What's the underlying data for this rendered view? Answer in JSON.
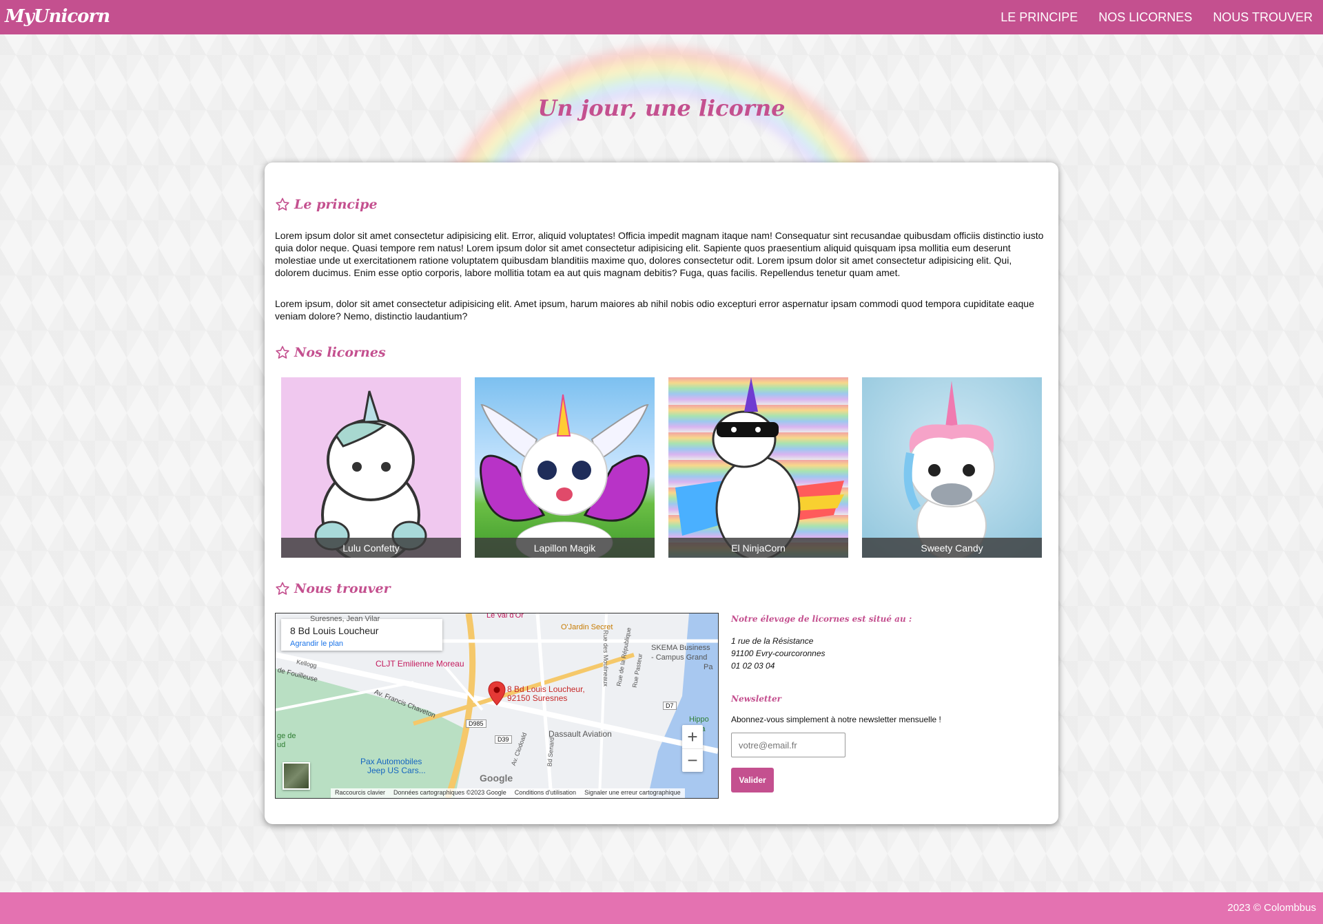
{
  "brand": "MyUnicorn",
  "nav": [
    "LE PRINCIPE",
    "NOS LICORNES",
    "NOUS TROUVER"
  ],
  "hero": {
    "title": "Un jour, une licorne"
  },
  "principe": {
    "title": "Le principe",
    "p1": "Lorem ipsum dolor sit amet consectetur adipisicing elit. Error, aliquid voluptates! Officia impedit magnam itaque nam! Consequatur sint recusandae quibusdam officiis distinctio iusto quia dolor neque. Quasi tempore rem natus! Lorem ipsum dolor sit amet consectetur adipisicing elit. Sapiente quos praesentium aliquid quisquam ipsa mollitia eum deserunt molestiae unde ut exercitationem ratione voluptatem quibusdam blanditiis maxime quo, dolores consectetur odit. Lorem ipsum dolor sit amet consectetur adipisicing elit. Qui, dolorem ducimus. Enim esse optio corporis, labore mollitia totam ea aut quis magnam debitis? Fuga, quas facilis. Repellendus tenetur quam amet.",
    "p2": "Lorem ipsum, dolor sit amet consectetur adipisicing elit. Amet ipsum, harum maiores ab nihil nobis odio excepturi error aspernatur ipsam commodi quod tempora cupiditate eaque veniam dolore? Nemo, distinctio laudantium?"
  },
  "licornes": {
    "title": "Nos licornes",
    "items": [
      {
        "name": "Lulu Confetty",
        "bg": "#f0c8ef"
      },
      {
        "name": "Lapillon Magik",
        "bg": "#8ec8f4"
      },
      {
        "name": "El NinjaCorn",
        "bg": "#c8b8d8"
      },
      {
        "name": "Sweety Candy",
        "bg": "#a9d4e6"
      }
    ]
  },
  "trouver": {
    "title": "Nous trouver",
    "map": {
      "place_title": "8 Bd Louis Loucheur",
      "enlarge": "Agrandir le plan",
      "marker_line1": "8 Bd Louis Loucheur,",
      "marker_line2": "92150 Suresnes",
      "labels": {
        "ojardin": "O'Jardin Secret",
        "cljt": "CLJT Emilienne Moreau",
        "skema": "SKEMA Business",
        "skema2": "- Campus Grand",
        "dassault": "Dassault Aviation",
        "pax": "Pax Automobiles",
        "jeep": "Jeep US Cars...",
        "francis": "Av. Francis Chaveton",
        "fouilleuse": "de Fouilleuse",
        "kellogg": "Kellogg",
        "levaldor": "Le Val d'Or",
        "suresnes": "Suresnes, Jean Vilar",
        "moulineaux": "Rue des Moulineaux",
        "republique": "Rue de la République",
        "pasteur": "Rue Pasteur",
        "clodoald": "Av. Clodoald",
        "senard": "Bd Senard",
        "hippo": "Hippo",
        "pa": "Pa",
        "pa2": "Pa",
        "gede": "ge de",
        "ud": "ud",
        "d985": "D985",
        "d39": "D39",
        "d7": "D7"
      },
      "google": "Google",
      "zoom_in": "+",
      "zoom_out": "−",
      "footer": [
        "Raccourcis clavier",
        "Données cartographiques ©2023 Google",
        "Conditions d'utilisation",
        "Signaler une erreur cartographique"
      ]
    },
    "location_heading": "Notre élevage de licornes est situé au :",
    "address_lines": [
      "1 rue de la Résistance",
      "91100 Evry-courcoronnes",
      "01 02 03 04"
    ],
    "newsletter": {
      "title": "Newsletter",
      "text": "Abonnez-vous simplement à notre newsletter mensuelle !",
      "placeholder": "votre@email.fr",
      "button": "Valider"
    }
  },
  "footer": "2023 © Colombbus",
  "colors": {
    "primary": "#c4508f",
    "footer": "#e472b1"
  }
}
